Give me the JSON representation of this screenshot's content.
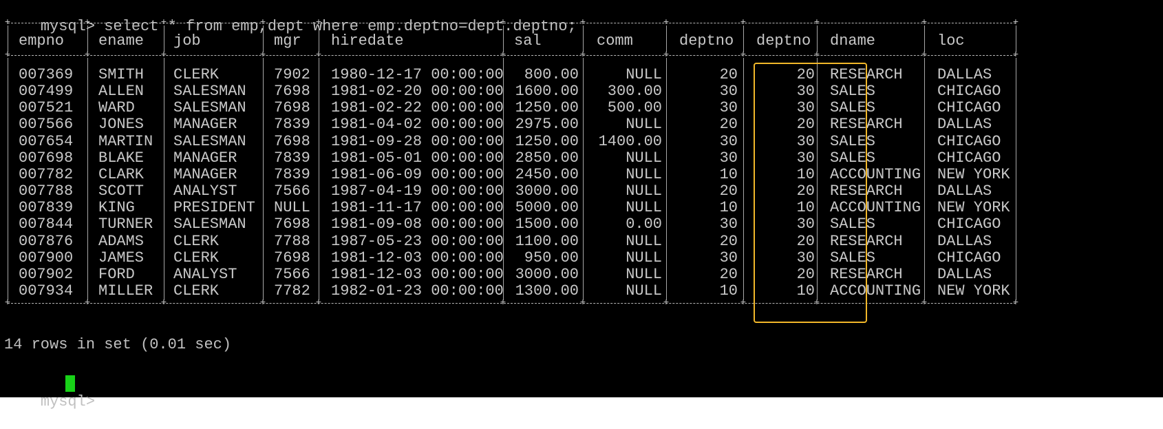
{
  "terminal": {
    "prompt": "mysql>",
    "command": "select * from emp,dept where emp.deptno=dept.deptno;",
    "result_status": "14 rows in set (0.01 sec)",
    "next_prompt": "mysql>",
    "highlight_color": "#f2b82a",
    "cursor_color": "#18d218",
    "background_color": "#000000",
    "text_color": "#c0c0c0"
  },
  "table": {
    "columns": [
      "empno",
      "ename",
      "job",
      "mgr",
      "hiredate",
      "sal",
      "comm",
      "deptno",
      "deptno",
      "dname",
      "loc"
    ],
    "rows": [
      [
        "007369",
        "SMITH",
        "CLERK",
        "7902",
        "1980-12-17 00:00:00",
        "800.00",
        "NULL",
        "20",
        "20",
        "RESEARCH",
        "DALLAS"
      ],
      [
        "007499",
        "ALLEN",
        "SALESMAN",
        "7698",
        "1981-02-20 00:00:00",
        "1600.00",
        "300.00",
        "30",
        "30",
        "SALES",
        "CHICAGO"
      ],
      [
        "007521",
        "WARD",
        "SALESMAN",
        "7698",
        "1981-02-22 00:00:00",
        "1250.00",
        "500.00",
        "30",
        "30",
        "SALES",
        "CHICAGO"
      ],
      [
        "007566",
        "JONES",
        "MANAGER",
        "7839",
        "1981-04-02 00:00:00",
        "2975.00",
        "NULL",
        "20",
        "20",
        "RESEARCH",
        "DALLAS"
      ],
      [
        "007654",
        "MARTIN",
        "SALESMAN",
        "7698",
        "1981-09-28 00:00:00",
        "1250.00",
        "1400.00",
        "30",
        "30",
        "SALES",
        "CHICAGO"
      ],
      [
        "007698",
        "BLAKE",
        "MANAGER",
        "7839",
        "1981-05-01 00:00:00",
        "2850.00",
        "NULL",
        "30",
        "30",
        "SALES",
        "CHICAGO"
      ],
      [
        "007782",
        "CLARK",
        "MANAGER",
        "7839",
        "1981-06-09 00:00:00",
        "2450.00",
        "NULL",
        "10",
        "10",
        "ACCOUNTING",
        "NEW YORK"
      ],
      [
        "007788",
        "SCOTT",
        "ANALYST",
        "7566",
        "1987-04-19 00:00:00",
        "3000.00",
        "NULL",
        "20",
        "20",
        "RESEARCH",
        "DALLAS"
      ],
      [
        "007839",
        "KING",
        "PRESIDENT",
        "NULL",
        "1981-11-17 00:00:00",
        "5000.00",
        "NULL",
        "10",
        "10",
        "ACCOUNTING",
        "NEW YORK"
      ],
      [
        "007844",
        "TURNER",
        "SALESMAN",
        "7698",
        "1981-09-08 00:00:00",
        "1500.00",
        "0.00",
        "30",
        "30",
        "SALES",
        "CHICAGO"
      ],
      [
        "007876",
        "ADAMS",
        "CLERK",
        "7788",
        "1987-05-23 00:00:00",
        "1100.00",
        "NULL",
        "20",
        "20",
        "RESEARCH",
        "DALLAS"
      ],
      [
        "007900",
        "JAMES",
        "CLERK",
        "7698",
        "1981-12-03 00:00:00",
        "950.00",
        "NULL",
        "30",
        "30",
        "SALES",
        "CHICAGO"
      ],
      [
        "007902",
        "FORD",
        "ANALYST",
        "7566",
        "1981-12-03 00:00:00",
        "3000.00",
        "NULL",
        "20",
        "20",
        "RESEARCH",
        "DALLAS"
      ],
      [
        "007934",
        "MILLER",
        "CLERK",
        "7782",
        "1982-01-23 00:00:00",
        "1300.00",
        "NULL",
        "10",
        "10",
        "ACCOUNTING",
        "NEW YORK"
      ]
    ],
    "column_alignments": [
      "left",
      "left",
      "left",
      "left",
      "left",
      "right",
      "right",
      "right",
      "right",
      "left",
      "left"
    ]
  }
}
